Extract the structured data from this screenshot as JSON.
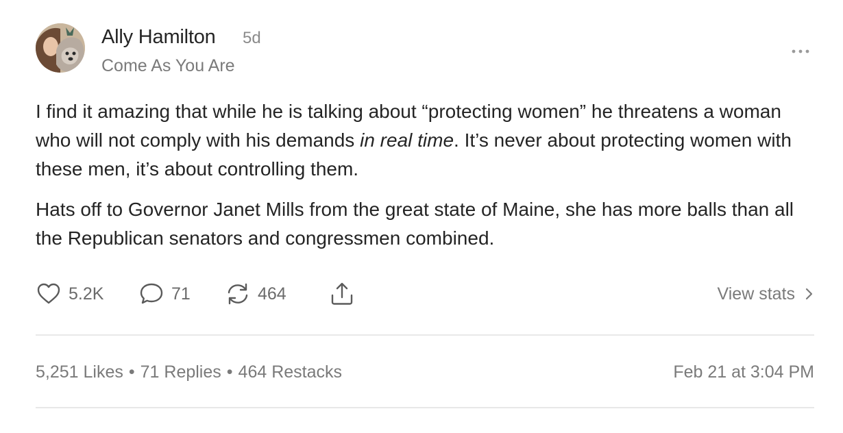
{
  "post": {
    "author": "Ally Hamilton",
    "age": "5d",
    "publication": "Come As You Are",
    "paragraph1_start": "I find it amazing that while he is talking about “protecting women” he threatens a woman who will not comply with his demands ",
    "paragraph1_emphasis": "in real time",
    "paragraph1_end": ". It’s never about protecting women with these men, it’s about controlling them.",
    "paragraph2": "Hats off to Governor Janet Mills from the great state of Maine, she has more balls than all the Republican senators and congressmen combined."
  },
  "actions": {
    "likes_count": "5.2K",
    "replies_count": "71",
    "restacks_count": "464",
    "view_stats_label": "View stats"
  },
  "footer": {
    "likes": "5,251 Likes",
    "replies": "71 Replies",
    "restacks": "464 Restacks",
    "separator": "•",
    "timestamp": "Feb 21 at 3:04 PM"
  },
  "icons": {
    "like": "heart-icon",
    "reply": "speech-bubble-icon",
    "restack": "restack-arrows-icon",
    "share": "share-upload-icon",
    "more": "more-horizontal-icon",
    "chevron": "chevron-right-icon"
  },
  "colors": {
    "text": "#242424",
    "muted": "#7a7a7a",
    "divider": "#e8e8e8"
  }
}
